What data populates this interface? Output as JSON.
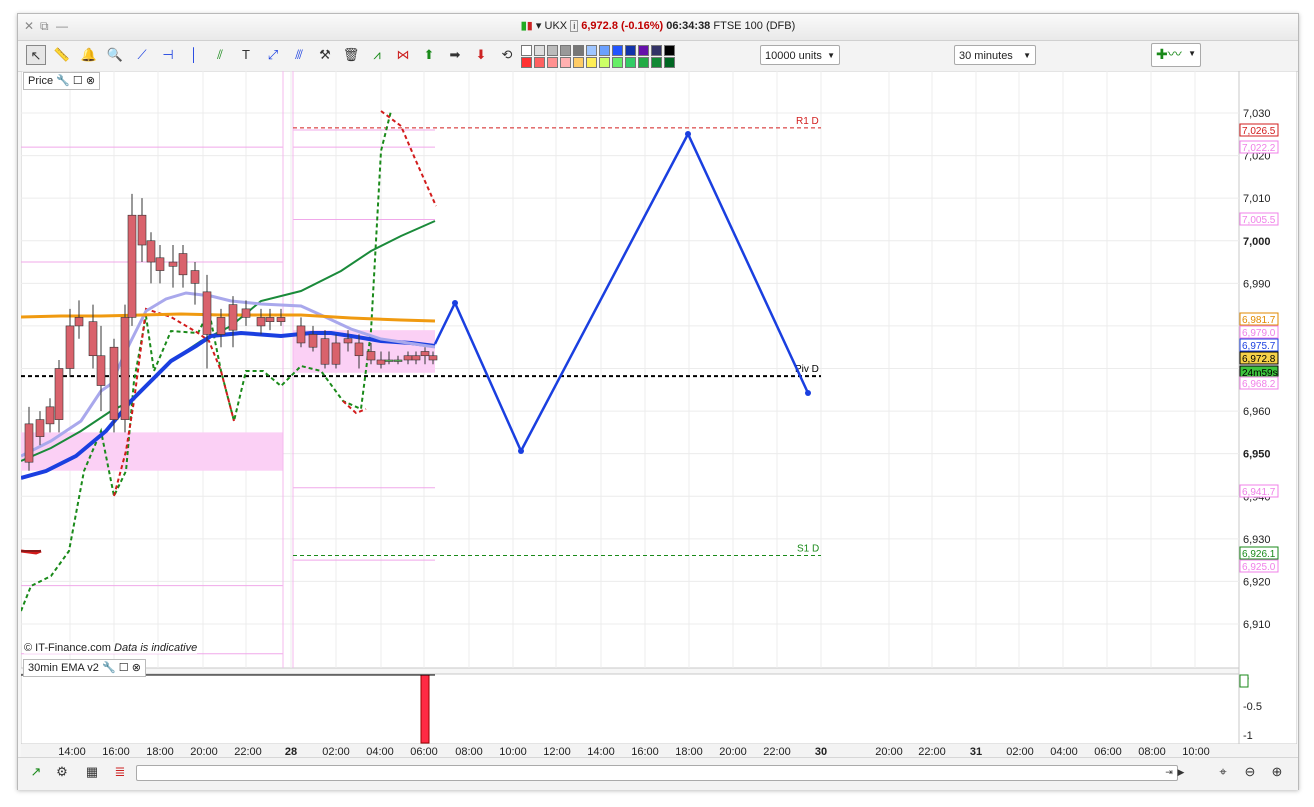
{
  "titlebar": {
    "instrument": "UKX",
    "price": "6,972.8",
    "change": "(-0.16%)",
    "time": "06:34:38",
    "market": "FTSE 100 (DFB)"
  },
  "toolbar": {
    "units_value": "10000 units",
    "interval_value": "30 minutes"
  },
  "price_panel": {
    "label": "Price",
    "copyright": "© IT-Finance.com",
    "indicative": "Data is indicative",
    "y_ticks": [
      "7,030",
      "7,020",
      "7,010",
      "7,000",
      "6,990",
      "6,960",
      "6,950",
      "6,940",
      "6,930",
      "6,920",
      "6,910"
    ],
    "tags": [
      {
        "text": "7,026.5",
        "color": "#d21c1c",
        "fill": "#ffffff"
      },
      {
        "text": "7,022.2",
        "color": "#f080e8",
        "fill": "#ffffff"
      },
      {
        "text": "7,005.5",
        "color": "#f080e8",
        "fill": "#ffffff"
      },
      {
        "text": "6,981.7",
        "color": "#e08a00",
        "fill": "#ffffff"
      },
      {
        "text": "6,979.0",
        "color": "#f080e8",
        "fill": "#ffffff"
      },
      {
        "text": "6,975.7",
        "color": "#1a3fe0",
        "fill": "#ffffff"
      },
      {
        "text": "6,972.8",
        "color": "#000000",
        "fill": "#f6d24a"
      },
      {
        "text": "24m59s",
        "color": "#000000",
        "fill": "#3ec43e"
      },
      {
        "text": "6,968.2",
        "color": "#f080e8",
        "fill": "#ffffff"
      },
      {
        "text": "6,941.7",
        "color": "#f080e8",
        "fill": "#ffffff"
      },
      {
        "text": "6,926.1",
        "color": "#1a8a1a",
        "fill": "#ffffff"
      },
      {
        "text": "6,925.0",
        "color": "#f080e8",
        "fill": "#ffffff"
      }
    ],
    "pivot_labels": {
      "r1": "R1 D",
      "piv": "Piv D",
      "s1": "S1 D"
    }
  },
  "ema_panel": {
    "label": "30min EMA v2",
    "y_ticks": [
      "0",
      "-0.5",
      "-1"
    ]
  },
  "time_axis": [
    "14:00",
    "16:00",
    "18:00",
    "20:00",
    "22:00",
    "28",
    "02:00",
    "04:00",
    "06:00",
    "08:00",
    "10:00",
    "12:00",
    "14:00",
    "16:00",
    "18:00",
    "20:00",
    "22:00",
    "30",
    "20:00",
    "22:00",
    "31",
    "02:00",
    "04:00",
    "06:00",
    "08:00",
    "10:00"
  ],
  "colors": {
    "up_candle": "#5cc95c",
    "down_candle": "#d9626c",
    "pink_band": "#fbd0f5",
    "blue_line": "#1a3fe0",
    "green_line": "#1a8a3a",
    "orange_line": "#f09a10"
  }
}
